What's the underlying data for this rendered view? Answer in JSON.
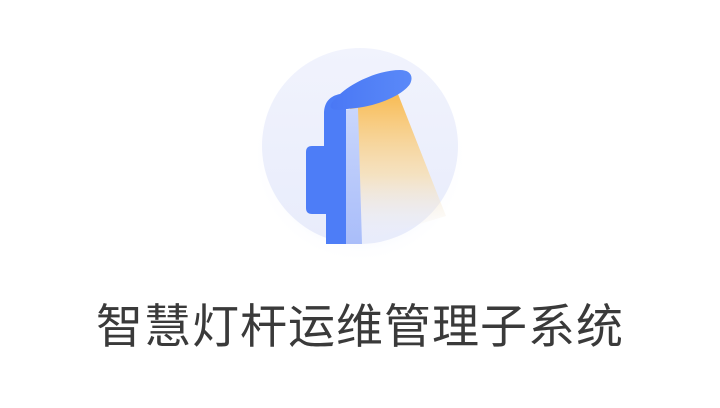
{
  "app": {
    "title": "智慧灯杆运维管理子系统",
    "logo_icon": "street-lamp-icon"
  },
  "colors": {
    "background": "#ffffff",
    "circle_fill": "#eef1fc",
    "lamp_blue": "#4d7df7",
    "lamp_light_blue": "#b7c8fb",
    "light_beam": "#f8c863",
    "title_text": "#3a3a3a"
  }
}
